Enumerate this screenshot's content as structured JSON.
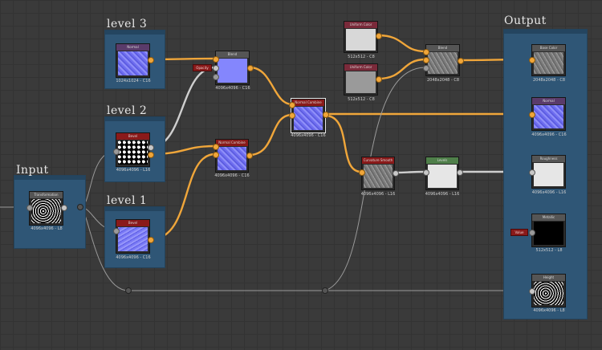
{
  "frames": {
    "input": {
      "title": "Input"
    },
    "level3": {
      "title": "level 3"
    },
    "level2": {
      "title": "level 2"
    },
    "level1": {
      "title": "level 1"
    },
    "output": {
      "title": "Output"
    }
  },
  "nodes": {
    "input_transform": {
      "label": "Transformation",
      "res": "4096x4096 - L8"
    },
    "level3_normal": {
      "label": "Normal",
      "res": "1024x1024 - C16"
    },
    "level2_bevel": {
      "label": "Bevel",
      "res": "4096x4096 - L16"
    },
    "level1_bevel": {
      "label": "Bevel",
      "res": "4096x4096 - C16"
    },
    "blend_top": {
      "label": "Blend",
      "res": "4096x4096 - C16",
      "tag": "Opacity"
    },
    "normal_combine_mid": {
      "label": "Normal Combine",
      "res": "4096x4096 - C16"
    },
    "normal_combine_main": {
      "label": "Normal Combine",
      "res": "4096x4096 - C16"
    },
    "uniform_color_1": {
      "label": "Uniform Color",
      "res": "512x512 - C8"
    },
    "uniform_color_2": {
      "label": "Uniform Color",
      "res": "512x512 - C8"
    },
    "blend_base": {
      "label": "Blend",
      "res": "2048x2048 - C8"
    },
    "curvature_smooth": {
      "label": "Curvature Smooth",
      "res": "4096x4096 - L16"
    },
    "levels": {
      "label": "Levels",
      "res": "4096x4096 - L16"
    },
    "out_basecolor": {
      "label": "Base Color",
      "res": "2048x2048 - C8"
    },
    "out_normal": {
      "label": "Normal",
      "res": "4096x4096 - C16"
    },
    "out_roughness": {
      "label": "Roughness",
      "res": "4096x4096 - L16"
    },
    "out_metallic": {
      "label": "Metallic",
      "res": "512x512 - L8",
      "tag": "Value"
    },
    "out_height": {
      "label": "Height",
      "res": "4096x4096 - L8"
    }
  },
  "colors": {
    "wire_data": "#f0a63a",
    "wire_grey": "#c8c8c8",
    "frame_bg": "#2f5676",
    "canvas_bg": "#3a3a3a"
  }
}
